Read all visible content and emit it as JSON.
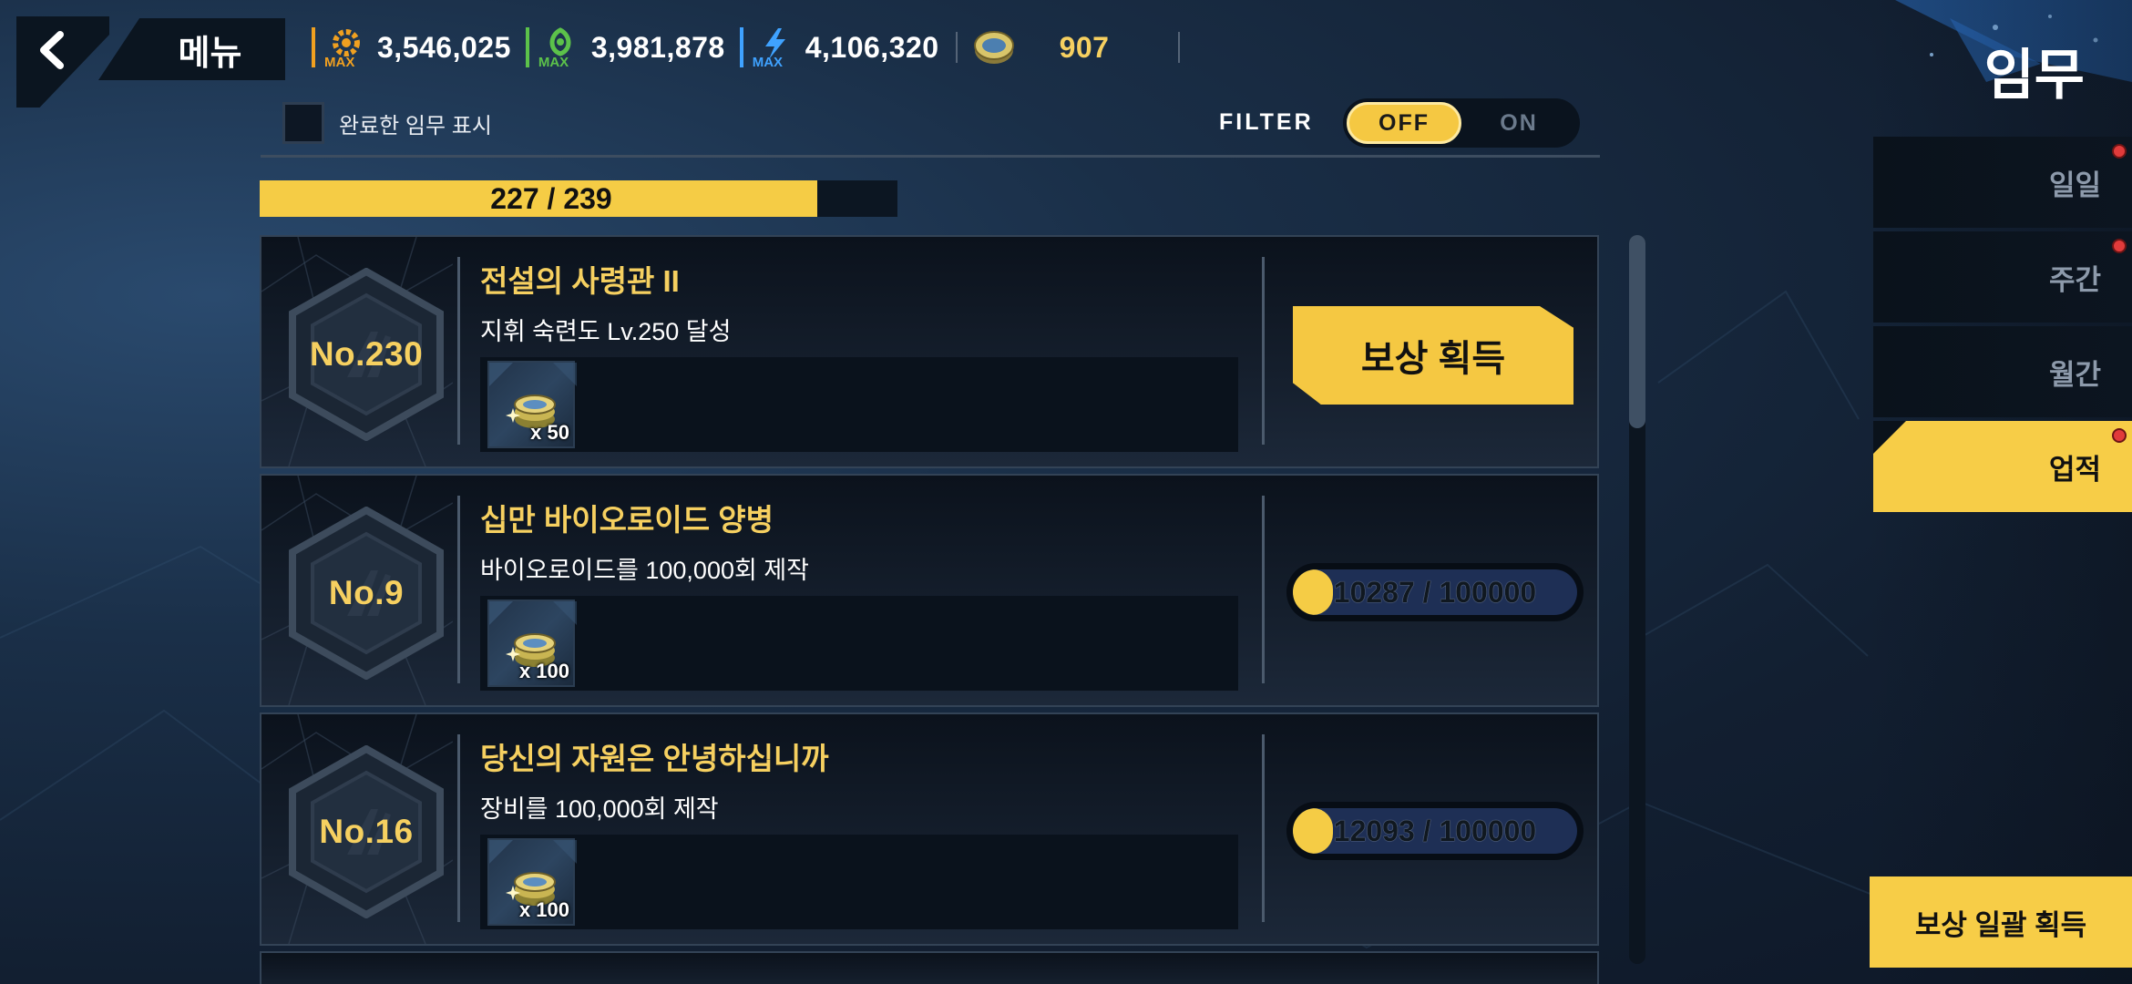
{
  "header": {
    "menu_label": "메뉴",
    "title": "임무",
    "resources": [
      {
        "icon": "gear-max-icon",
        "max_label": "MAX",
        "value": "3,546,025",
        "color": "#f0a020"
      },
      {
        "icon": "bio-max-icon",
        "max_label": "MAX",
        "value": "3,981,878",
        "color": "#5cc24a"
      },
      {
        "icon": "energy-max-icon",
        "max_label": "MAX",
        "value": "4,106,320",
        "color": "#3fa2ff"
      }
    ],
    "coin": {
      "icon": "coin-icon",
      "value": "907",
      "color": "#f6d060"
    }
  },
  "filter_bar": {
    "show_completed_label": "완료한 임무 표시",
    "filter_label": "FILTER",
    "off_label": "OFF",
    "on_label": "ON",
    "selected": "OFF"
  },
  "overall_progress": {
    "text": "227 / 239",
    "current": 227,
    "total": 239
  },
  "missions": [
    {
      "number": "No.230",
      "title": "전설의 사령관 II",
      "description": "지휘 숙련도 Lv.250 달성",
      "reward_count": "x 50",
      "state": "claimable",
      "claim_label": "보상 획득"
    },
    {
      "number": "No.9",
      "title": "십만 바이오로이드 양병",
      "description": "바이오로이드를 100,000회 제작",
      "reward_count": "x 100",
      "state": "in_progress",
      "progress_text": "10287 / 100000",
      "progress_current": 10287,
      "progress_total": 100000
    },
    {
      "number": "No.16",
      "title": "당신의 자원은 안녕하십니까",
      "description": "장비를 100,000회 제작",
      "reward_count": "x 100",
      "state": "in_progress",
      "progress_text": "12093 / 100000",
      "progress_current": 12093,
      "progress_total": 100000
    }
  ],
  "tabs": [
    {
      "label": "일일",
      "active": false,
      "notification": true
    },
    {
      "label": "주간",
      "active": false,
      "notification": true
    },
    {
      "label": "월간",
      "active": false,
      "notification": false
    },
    {
      "label": "업적",
      "active": true,
      "notification": true
    }
  ],
  "claim_all_label": "보상 일괄 획득",
  "colors": {
    "accent": "#f7cd47",
    "title_gold": "#f6d060",
    "notification": "#e13b3b"
  }
}
